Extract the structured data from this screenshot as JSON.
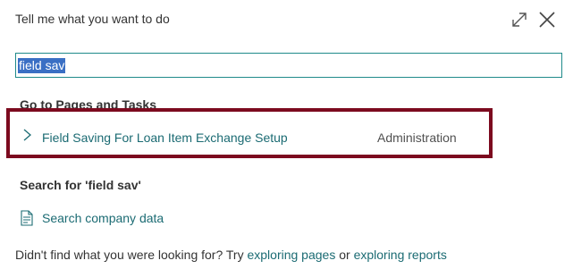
{
  "dialog": {
    "title": "Tell me what you want to do"
  },
  "search": {
    "value": "field sav"
  },
  "pages_section": {
    "header": "Go to Pages and Tasks",
    "results": [
      {
        "name": "Field Saving For Loan Item Exchange Setup",
        "department": "Administration"
      }
    ]
  },
  "search_for": {
    "header": "Search for 'field sav'",
    "company_data_label": "Search company data"
  },
  "footer": {
    "text": "Didn't find what you were looking for? Try ",
    "link_pages": "exploring pages",
    "or_text": " or ",
    "link_reports": "exploring reports"
  },
  "icons": {
    "expand": "expand-icon",
    "close": "close-icon",
    "chevron": "chevron-right-icon",
    "document": "document-search-icon"
  },
  "colors": {
    "accent": "#1b6b73",
    "input_border": "#1f8a8a",
    "highlight_border": "#7c0a1f",
    "selection": "#3a6fc4"
  }
}
